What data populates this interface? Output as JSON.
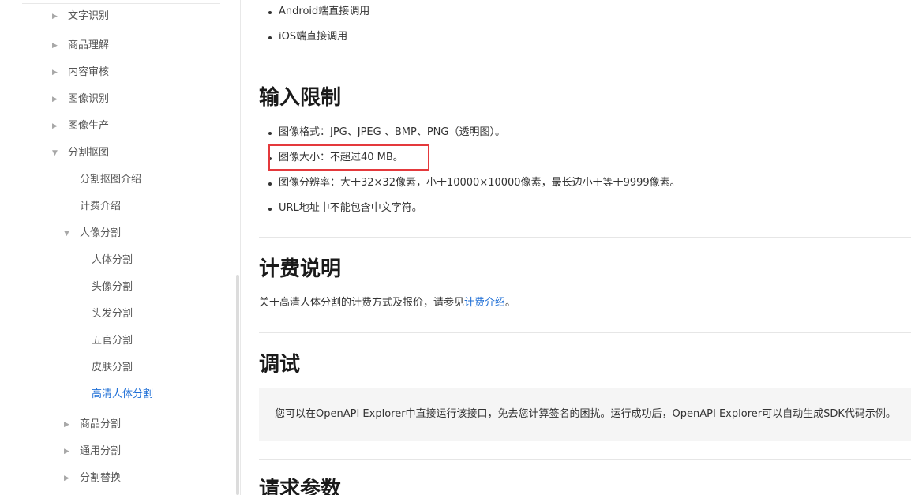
{
  "sidebar": {
    "clipped_top_item": "文字识别",
    "items": [
      {
        "label": "商品理解",
        "caret": "▶"
      },
      {
        "label": "内容审核",
        "caret": "▶"
      },
      {
        "label": "图像识别",
        "caret": "▶"
      },
      {
        "label": "图像生产",
        "caret": "▶"
      },
      {
        "label": "分割抠图",
        "caret": "▼"
      },
      {
        "label": "分割抠图介绍"
      },
      {
        "label": "计费介绍"
      },
      {
        "label": "人像分割",
        "caret": "▼"
      },
      {
        "label": "人体分割"
      },
      {
        "label": "头像分割"
      },
      {
        "label": "头发分割"
      },
      {
        "label": "五官分割"
      },
      {
        "label": "皮肤分割"
      },
      {
        "label": "高清人体分割",
        "active": true
      },
      {
        "label": "商品分割",
        "caret": "▶"
      },
      {
        "label": "通用分割",
        "caret": "▶"
      },
      {
        "label": "分割替换",
        "caret": "▶"
      }
    ]
  },
  "main": {
    "top_links": [
      "Android端直接调用",
      "iOS端直接调用"
    ],
    "input_limits": {
      "heading": "输入限制",
      "items": [
        "图像格式：JPG、JPEG 、BMP、PNG（透明图）。",
        "图像大小：不超过40 MB。",
        "图像分辨率：大于32×32像素，小于10000×10000像素，最长边小于等于9999像素。",
        "URL地址中不能包含中文字符。"
      ]
    },
    "billing": {
      "heading": "计费说明",
      "text_before": "关于高清人体分割的计费方式及报价，请参见",
      "link": "计费介绍",
      "text_after": "。"
    },
    "debug": {
      "heading": "调试",
      "text": "您可以在OpenAPI Explorer中直接运行该接口，免去您计算签名的困扰。运行成功后，OpenAPI Explorer可以自动生成SDK代码示例。"
    },
    "request_params": {
      "heading": "请求参数"
    }
  },
  "colors": {
    "link": "#1f6fd6",
    "highlight": "#e4393c",
    "debug_bg": "#f5f5f5"
  }
}
